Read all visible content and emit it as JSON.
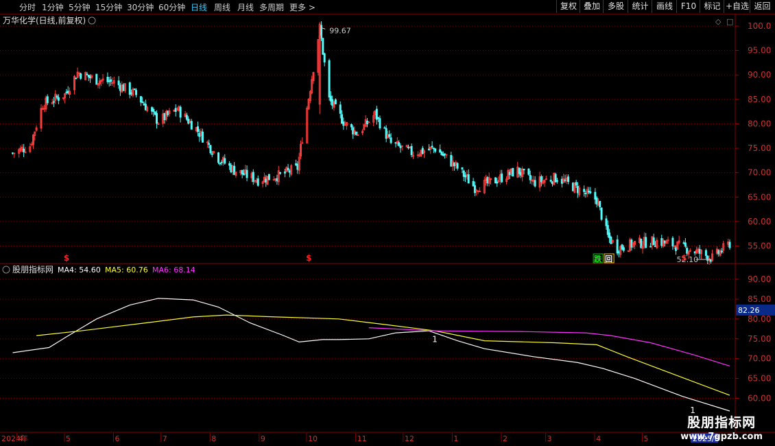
{
  "toolbar": {
    "periods": [
      "分时",
      "1分钟",
      "5分钟",
      "15分钟",
      "30分钟",
      "60分钟",
      "日线",
      "周线",
      "月线",
      "多周期",
      "更多 >"
    ],
    "active": "日线",
    "right_buttons": [
      "复权",
      "叠加",
      "多股",
      "统计",
      "画线",
      "F10",
      "标记",
      "+自选",
      "返回"
    ]
  },
  "brand": {
    "name": "股朋指标网",
    "url": "www.7gpzb.com"
  },
  "chart_data": [
    {
      "type": "candlestick",
      "title": "万华化学(日线,前复权)",
      "y_ticks": [
        "100.0",
        "95.00",
        "90.00",
        "85.00",
        "80.00",
        "75.00",
        "70.00",
        "65.00",
        "60.00",
        "55.00"
      ],
      "ylim": [
        52,
        101.5
      ],
      "annotations": {
        "high": "99.67",
        "low": "52.10",
        "signals": [
          "跌",
          "回"
        ],
        "markers": [
          "$",
          "$",
          "$"
        ]
      },
      "price_path": [
        [
          "2024-03-28",
          74
        ],
        [
          "2024-04-08",
          75.5
        ],
        [
          "2024-04-16",
          84
        ],
        [
          "2024-04-30",
          86
        ],
        [
          "2024-05-08",
          90.5
        ],
        [
          "2024-05-20",
          89
        ],
        [
          "2024-05-31",
          88.5
        ],
        [
          "2024-06-14",
          86
        ],
        [
          "2024-06-28",
          80.5
        ],
        [
          "2024-07-10",
          83
        ],
        [
          "2024-07-22",
          79
        ],
        [
          "2024-08-05",
          73
        ],
        [
          "2024-08-15",
          70.5
        ],
        [
          "2024-08-30",
          68.5
        ],
        [
          "2024-09-13",
          69.5
        ],
        [
          "2024-09-24",
          71
        ],
        [
          "2024-10-08",
          99.67
        ],
        [
          "2024-10-14",
          85
        ],
        [
          "2024-10-24",
          80
        ],
        [
          "2024-11-01",
          78
        ],
        [
          "2024-11-12",
          82
        ],
        [
          "2024-11-22",
          76
        ],
        [
          "2024-12-06",
          74
        ],
        [
          "2024-12-20",
          75
        ],
        [
          "2025-01-03",
          71
        ],
        [
          "2025-01-14",
          67
        ],
        [
          "2025-01-24",
          68
        ],
        [
          "2025-02-10",
          70.5
        ],
        [
          "2025-02-20",
          68
        ],
        [
          "2025-03-07",
          69
        ],
        [
          "2025-03-21",
          66.5
        ],
        [
          "2025-04-01",
          64.5
        ],
        [
          "2025-04-08",
          57
        ],
        [
          "2025-04-14",
          54.5
        ],
        [
          "2025-04-25",
          55.5
        ],
        [
          "2025-05-09",
          56
        ],
        [
          "2025-05-23",
          55
        ],
        [
          "2025-06-06",
          53.5
        ],
        [
          "2025-06-13",
          52.5
        ],
        [
          "2025-06-24",
          55.5
        ]
      ]
    },
    {
      "type": "line",
      "title": "股朋指标网",
      "y_ticks": [
        "90.00",
        "85.00",
        "80.00",
        "75.00",
        "70.00",
        "65.00",
        "60.00"
      ],
      "current_value": "82.26",
      "ylim": [
        56.5,
        92
      ],
      "series": [
        {
          "name": "MA4",
          "value": "54.60",
          "color": "#ffffff",
          "points": [
            [
              "2024-03-28",
              71.5
            ],
            [
              "2024-04-20",
              72.8
            ],
            [
              "2024-05-01",
              75.5
            ],
            [
              "2024-05-20",
              80
            ],
            [
              "2024-06-10",
              83.5
            ],
            [
              "2024-06-28",
              85.2
            ],
            [
              "2024-07-20",
              84.8
            ],
            [
              "2024-08-05",
              83
            ],
            [
              "2024-08-25",
              79
            ],
            [
              "2024-09-14",
              76
            ],
            [
              "2024-09-25",
              74.2
            ],
            [
              "2024-10-10",
              74.8
            ],
            [
              "2024-10-20",
              74.8
            ],
            [
              "2024-11-08",
              75
            ],
            [
              "2024-11-25",
              76.5
            ],
            [
              "2024-12-16",
              77
            ],
            [
              "2025-01-03",
              74.5
            ],
            [
              "2025-01-20",
              72.5
            ],
            [
              "2025-02-20",
              70.5
            ],
            [
              "2025-03-20",
              69
            ],
            [
              "2025-04-05",
              67.5
            ],
            [
              "2025-04-25",
              65
            ],
            [
              "2025-05-25",
              60.5
            ],
            [
              "2025-06-24",
              56.8
            ]
          ]
        },
        {
          "name": "MA5",
          "value": "60.76",
          "color": "#ffff33",
          "points": [
            [
              "2024-04-12",
              75.8
            ],
            [
              "2024-05-10",
              77
            ],
            [
              "2024-06-20",
              79
            ],
            [
              "2024-07-20",
              80.5
            ],
            [
              "2024-08-10",
              81
            ],
            [
              "2024-09-10",
              80.5
            ],
            [
              "2024-10-20",
              80
            ],
            [
              "2024-11-20",
              78.5
            ],
            [
              "2024-12-20",
              77
            ],
            [
              "2025-01-20",
              74.5
            ],
            [
              "2025-03-05",
              74
            ],
            [
              "2025-04-01",
              73.5
            ],
            [
              "2025-04-20",
              70.5
            ],
            [
              "2025-05-20",
              66
            ],
            [
              "2025-06-24",
              60.76
            ]
          ]
        },
        {
          "name": "MA6",
          "value": "68.14",
          "color": "#ff33ff",
          "points": [
            [
              "2024-11-08",
              77.8
            ],
            [
              "2024-12-20",
              77
            ],
            [
              "2025-02-15",
              76.8
            ],
            [
              "2025-03-25",
              76.5
            ],
            [
              "2025-04-10",
              75.8
            ],
            [
              "2025-05-05",
              74
            ],
            [
              "2025-06-01",
              71
            ],
            [
              "2025-06-24",
              68.14
            ]
          ]
        }
      ],
      "labels": [
        "1",
        "1"
      ]
    }
  ],
  "x_axis": {
    "labels": [
      [
        "2024-03-28",
        "2024年"
      ],
      [
        "2024-04-01",
        "4"
      ],
      [
        "2024-05-01",
        "5"
      ],
      [
        "2024-06-01",
        "6"
      ],
      [
        "2024-07-01",
        "7"
      ],
      [
        "2024-08-01",
        "8"
      ],
      [
        "2024-09-01",
        "9"
      ],
      [
        "2024-10-01",
        "10"
      ],
      [
        "2024-11-01",
        "11"
      ],
      [
        "2024-12-01",
        "12"
      ],
      [
        "2025-01-01",
        "1"
      ],
      [
        "2025-02-01",
        "2"
      ],
      [
        "2025-03-01",
        "3"
      ],
      [
        "2025-04-01",
        "4"
      ],
      [
        "2025-05-01",
        "5"
      ],
      [
        "2025-06-01",
        "2025/0"
      ]
    ]
  }
}
